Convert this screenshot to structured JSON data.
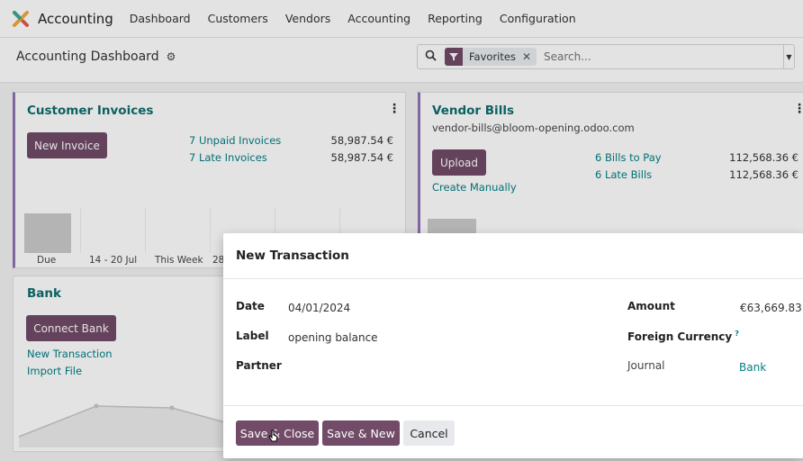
{
  "app": {
    "name": "Accounting",
    "icon": "odoo-logo-icon"
  },
  "nav": {
    "items": [
      "Dashboard",
      "Customers",
      "Vendors",
      "Accounting",
      "Reporting",
      "Configuration"
    ]
  },
  "control": {
    "title": "Accounting Dashboard",
    "search": {
      "facet": "Favorites",
      "placeholder": "Search..."
    }
  },
  "customer_invoices": {
    "title": "Customer Invoices",
    "new_button": "New Invoice",
    "rows": [
      {
        "label": "7 Unpaid Invoices",
        "amount": "58,987.54 €"
      },
      {
        "label": "7 Late Invoices",
        "amount": "58,987.54 €"
      }
    ],
    "chart_labels": [
      "Due",
      "14 - 20 Jul",
      "This Week",
      "28"
    ]
  },
  "vendor_bills": {
    "title": "Vendor Bills",
    "email": "vendor-bills@bloom-opening.odoo.com",
    "upload_button": "Upload",
    "create_manually": "Create Manually",
    "rows": [
      {
        "label": "6 Bills to Pay",
        "amount": "112,568.36 €"
      },
      {
        "label": "6 Late Bills",
        "amount": "112,568.36 €"
      }
    ]
  },
  "bank": {
    "title": "Bank",
    "connect_button": "Connect Bank",
    "new_transaction": "New Transaction",
    "import_file": "Import File"
  },
  "modal": {
    "title": "New Transaction",
    "fields": {
      "date_label": "Date",
      "date_value": "04/01/2024",
      "label_label": "Label",
      "label_value": "opening balance",
      "partner_label": "Partner",
      "amount_label": "Amount",
      "amount_value": "€63,669.83",
      "foreign_currency_label": "Foreign Currency",
      "foreign_currency_help": "?",
      "journal_label": "Journal",
      "journal_value": "Bank"
    },
    "buttons": {
      "save_close": "Save & Close",
      "save_new": "Save & New",
      "cancel": "Cancel"
    }
  },
  "colors": {
    "primary": "#714b67",
    "link": "#017e84",
    "title": "#0d6e6e",
    "accent": "#8f73b4"
  }
}
